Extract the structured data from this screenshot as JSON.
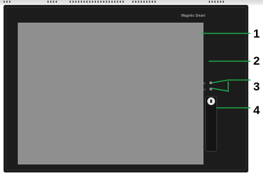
{
  "device": {
    "brand": "Magelis Smart",
    "led_labels": [
      "HC",
      "CH"
    ]
  },
  "callouts": [
    {
      "number": "1"
    },
    {
      "number": "2"
    },
    {
      "number": "3"
    },
    {
      "number": "4"
    }
  ],
  "colors": {
    "bezel": "#1c1c1c",
    "screen": "#8f8f8f",
    "callout_line": "#1ea84a"
  }
}
